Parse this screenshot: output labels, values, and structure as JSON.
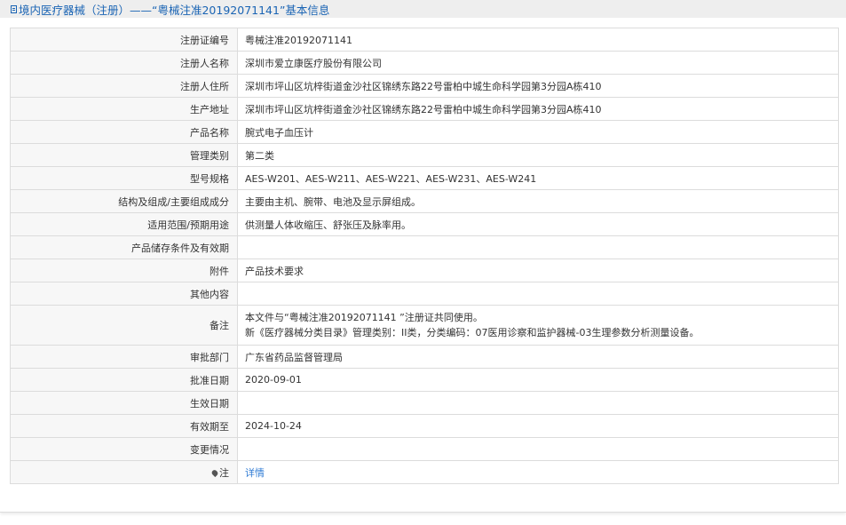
{
  "header": {
    "title": "境内医疗器械（注册）——“粤械注准20192071141”基本信息"
  },
  "rows": [
    {
      "label": "注册证编号",
      "value": "粤械注准20192071141"
    },
    {
      "label": "注册人名称",
      "value": "深圳市爱立康医疗股份有限公司"
    },
    {
      "label": "注册人住所",
      "value": "深圳市坪山区坑梓街道金沙社区锦绣东路22号雷柏中城生命科学园第3分园A栋410"
    },
    {
      "label": "生产地址",
      "value": "深圳市坪山区坑梓街道金沙社区锦绣东路22号雷柏中城生命科学园第3分园A栋410"
    },
    {
      "label": "产品名称",
      "value": "腕式电子血压计"
    },
    {
      "label": "管理类别",
      "value": "第二类"
    },
    {
      "label": "型号规格",
      "value": "AES-W201、AES-W211、AES-W221、AES-W231、AES-W241"
    },
    {
      "label": "结构及组成/主要组成成分",
      "value": "主要由主机、腕带、电池及显示屏组成。"
    },
    {
      "label": "适用范围/预期用途",
      "value": "供测量人体收缩压、舒张压及脉率用。"
    },
    {
      "label": "产品储存条件及有效期",
      "value": ""
    },
    {
      "label": "附件",
      "value": "产品技术要求"
    },
    {
      "label": "其他内容",
      "value": ""
    }
  ],
  "remark": {
    "label": "备注",
    "line1": "本文件与“粤械注准20192071141 ”注册证共同使用。",
    "line2": "新《医疗器械分类目录》管理类别：II类，分类编码：07医用诊察和监护器械-03生理参数分析测量设备。"
  },
  "rows2": [
    {
      "label": "审批部门",
      "value": "广东省药品监督管理局"
    },
    {
      "label": "批准日期",
      "value": "2020-09-01"
    },
    {
      "label": "生效日期",
      "value": ""
    },
    {
      "label": "有效期至",
      "value": "2024-10-24"
    },
    {
      "label": "变更情况",
      "value": ""
    }
  ],
  "note": {
    "label": "注",
    "link": "详情",
    "icon": "pin-icon"
  }
}
